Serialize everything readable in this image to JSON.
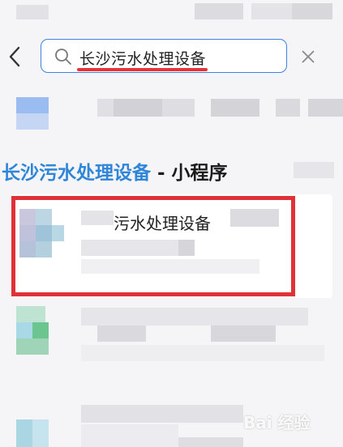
{
  "search": {
    "query": "长沙污水处理设备"
  },
  "section": {
    "keyword": "长沙污水处理设备",
    "suffix": " - 小程序"
  },
  "result": {
    "name": "污水处理设备"
  },
  "watermark": {
    "text": "Bai 经验"
  },
  "colors": {
    "accent": "#3c82e8",
    "highlight": "#e03038",
    "keyword": "#2f86d8"
  }
}
